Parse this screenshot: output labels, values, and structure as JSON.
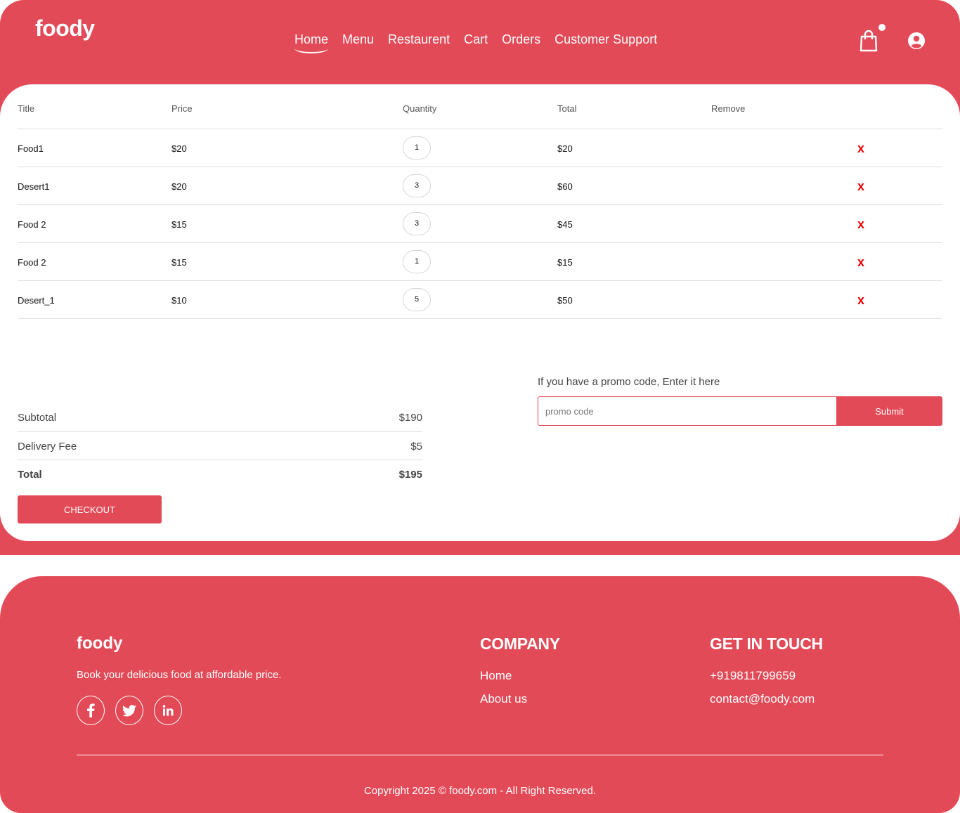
{
  "header": {
    "logo": "foody",
    "nav": [
      "Home",
      "Menu",
      "Restaurent",
      "Cart",
      "Orders",
      "Customer Support"
    ],
    "active_nav": "Home",
    "icons": [
      "shopping-bag-icon",
      "user-circle-icon"
    ]
  },
  "cart_table": {
    "columns": [
      "Title",
      "Price",
      "Quantity",
      "Total",
      "Remove"
    ],
    "rows": [
      {
        "title": "Food1",
        "price": "$20",
        "quantity": "1",
        "total": "$20",
        "remove": "x"
      },
      {
        "title": "Desert1",
        "price": "$20",
        "quantity": "3",
        "total": "$60",
        "remove": "x"
      },
      {
        "title": "Food 2",
        "price": "$15",
        "quantity": "3",
        "total": "$45",
        "remove": "x"
      },
      {
        "title": "Food 2",
        "price": "$15",
        "quantity": "1",
        "total": "$15",
        "remove": "x"
      },
      {
        "title": "Desert_1",
        "price": "$10",
        "quantity": "5",
        "total": "$50",
        "remove": "x"
      }
    ]
  },
  "summary": {
    "subtotal_label": "Subtotal",
    "subtotal": "$190",
    "delivery_label": "Delivery Fee",
    "delivery": "$5",
    "total_label": "Total",
    "total": "$195",
    "checkout_label": "CHECKOUT"
  },
  "promo": {
    "label": "If you have a promo code, Enter it here",
    "placeholder": "promo code",
    "value": "",
    "submit_label": "Submit"
  },
  "footer": {
    "logo": "foody",
    "tagline": "Book your delicious food at affordable price.",
    "social_icons": [
      "facebook-icon",
      "twitter-icon",
      "linkedin-icon"
    ],
    "company_heading": "COMPANY",
    "company_links": [
      "Home",
      "About us"
    ],
    "contact_heading": "GET IN TOUCH",
    "phone": "+919811799659",
    "email": "contact@foody.com",
    "copyright": "Copyright 2025 © foody.com - All Right Reserved."
  },
  "colors": {
    "brand": "#e34a57",
    "remove": "#e60000"
  }
}
